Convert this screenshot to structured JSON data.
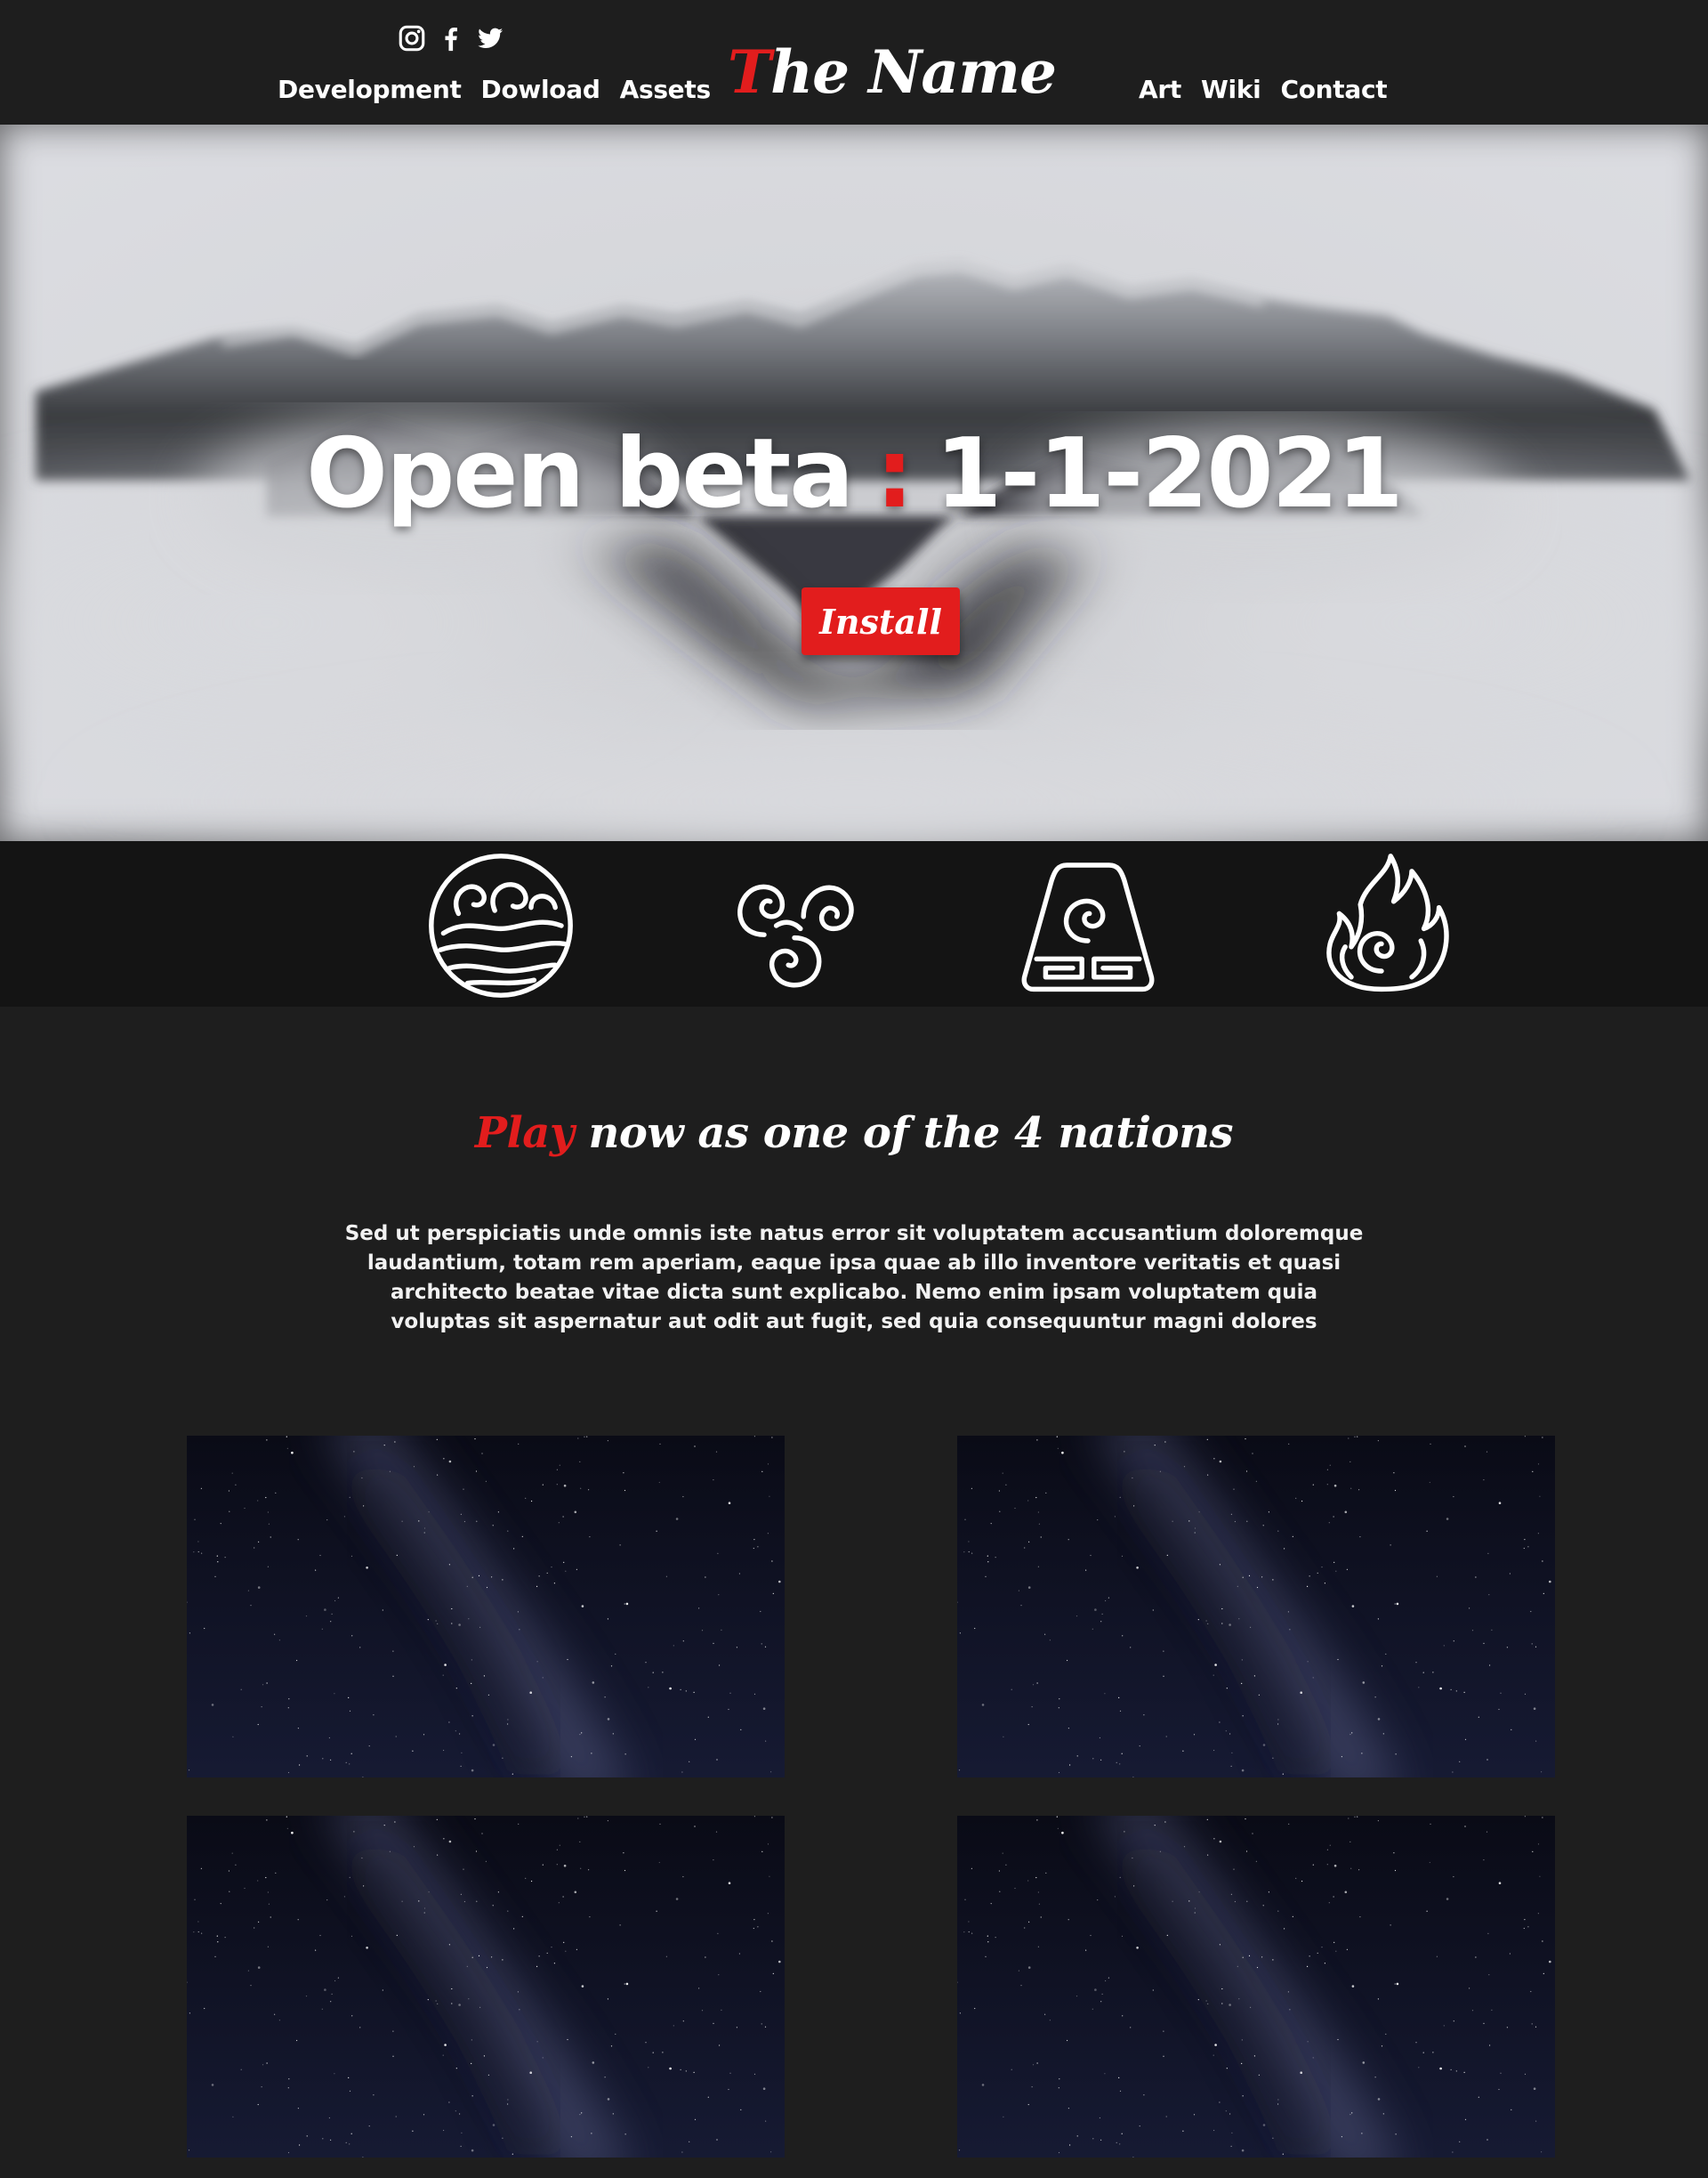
{
  "header": {
    "logo": {
      "first_letter": "T",
      "rest": "he Name"
    },
    "social": [
      {
        "icon": "instagram-icon",
        "label": "Instagram"
      },
      {
        "icon": "facebook-icon",
        "label": "Facebook"
      },
      {
        "icon": "twitter-icon",
        "label": "Twitter"
      }
    ],
    "nav_left": [
      "Development",
      "Dowload",
      "Assets"
    ],
    "nav_right": [
      "Art",
      "Wiki",
      "Contact"
    ]
  },
  "hero": {
    "title_left": "Open beta",
    "title_separator": ":",
    "title_right": "1-1-2021",
    "install_label": "Install",
    "background": "misty-mountains-image"
  },
  "nations": {
    "icons": [
      "water-tribe-icon",
      "air-nomads-icon",
      "earth-kingdom-icon",
      "fire-nation-icon"
    ]
  },
  "play": {
    "heading_accent": "Play",
    "heading_rest": "now as one of the 4 nations",
    "text": "Sed ut perspiciatis unde omnis iste natus error sit voluptatem accusantium doloremque laudantium, totam rem aperiam, eaque ipsa quae ab illo inventore veritatis et quasi architecto beatae vitae dicta sunt explicabo. Nemo enim ipsam voluptatem quia voluptas sit aspernatur aut odit aut fugit, sed quia consequuntur magni dolores"
  },
  "gallery": {
    "tiles": [
      "starry-sky-image",
      "starry-sky-image",
      "starry-sky-image",
      "starry-sky-image"
    ]
  },
  "colors": {
    "background": "#1e1e1e",
    "strip": "#141414",
    "accent": "#e21d1d",
    "text": "#ffffff"
  }
}
